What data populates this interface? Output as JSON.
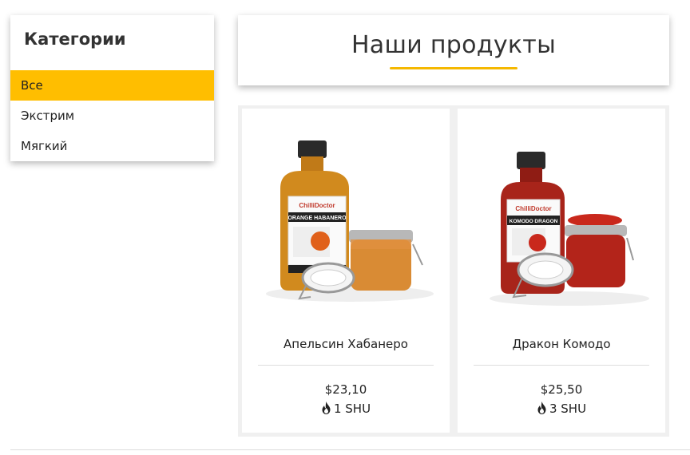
{
  "sidebar": {
    "title": "Категории",
    "items": [
      {
        "label": "Все",
        "active": true
      },
      {
        "label": "Экстрим",
        "active": false
      },
      {
        "label": "Мягкий",
        "active": false
      }
    ]
  },
  "header": {
    "title": "Наши продукты"
  },
  "products": [
    {
      "name": "Апельсин Хабанеро",
      "price": "$23,10",
      "heat": "1 SHU",
      "brand": "ChilliDoctor",
      "label": "ORANGE HABANERO",
      "color": "#d18a1e"
    },
    {
      "name": "Дракон Комодо",
      "price": "$25,50",
      "heat": "3 SHU",
      "brand": "ChilliDoctor",
      "label": "KOMODO DRAGON",
      "color": "#a8241a"
    }
  ],
  "colors": {
    "accent": "#ffbe00"
  }
}
